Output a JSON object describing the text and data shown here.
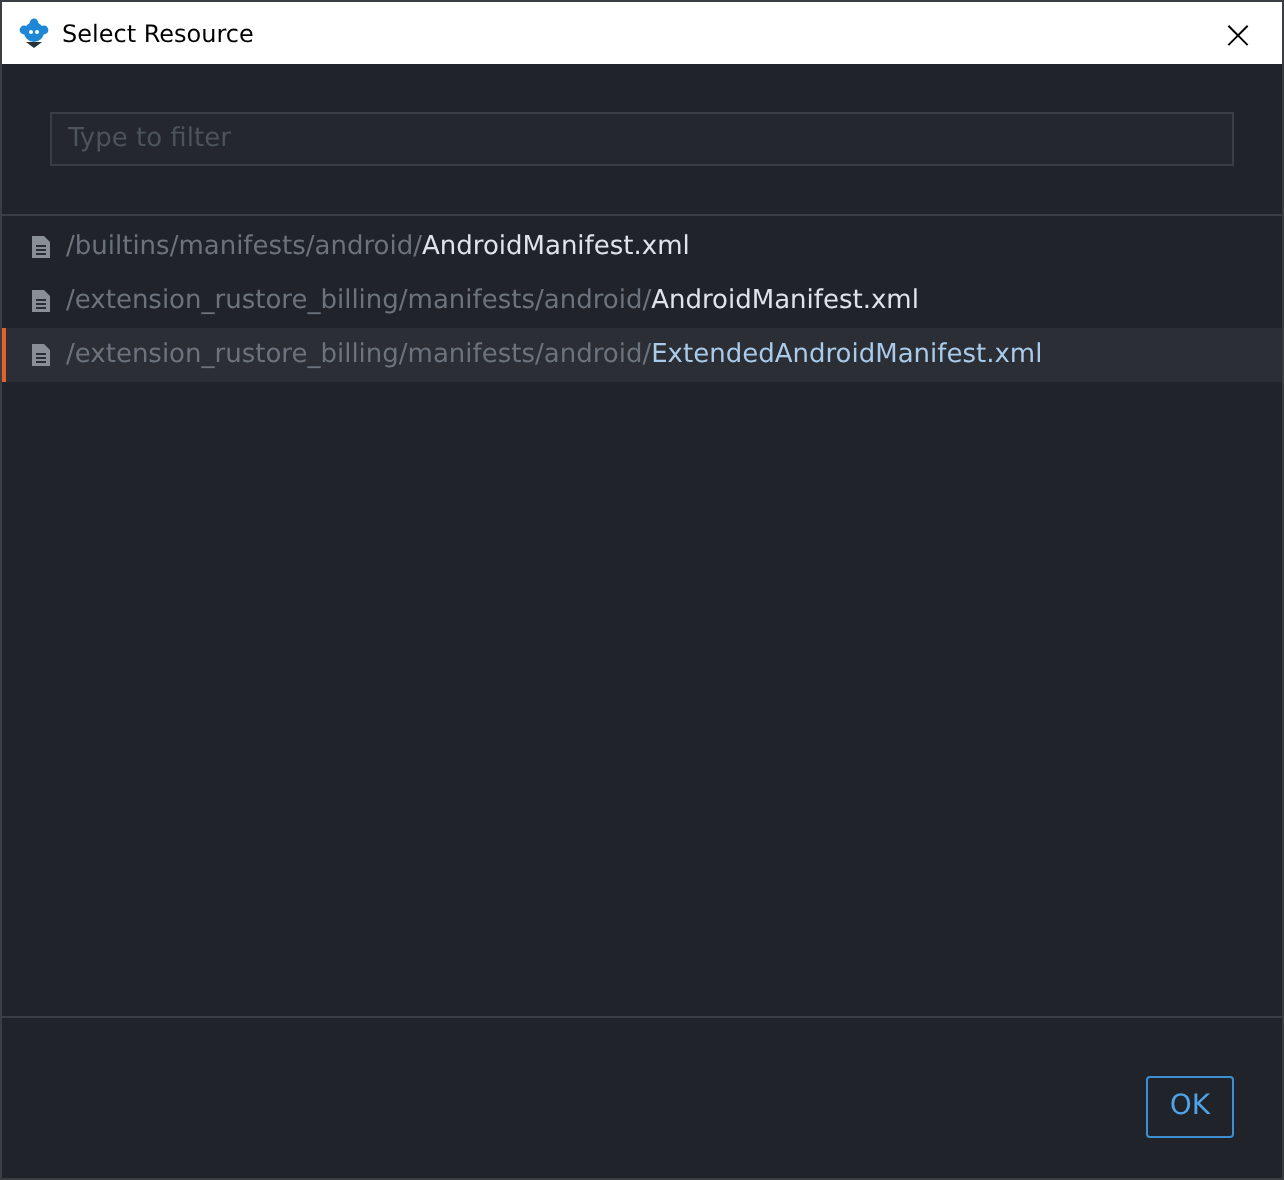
{
  "window": {
    "title": "Select Resource",
    "close": "×"
  },
  "filter": {
    "placeholder": "Type to filter"
  },
  "items": [
    {
      "dir": "/builtins/manifests/android/",
      "name": "AndroidManifest.xml",
      "selected": false
    },
    {
      "dir": "/extension_rustore_billing/manifests/android/",
      "name": "AndroidManifest.xml",
      "selected": false
    },
    {
      "dir": "/extension_rustore_billing/manifests/android/",
      "name": "ExtendedAndroidManifest.xml",
      "selected": true
    }
  ],
  "buttons": [
    "OK"
  ]
}
